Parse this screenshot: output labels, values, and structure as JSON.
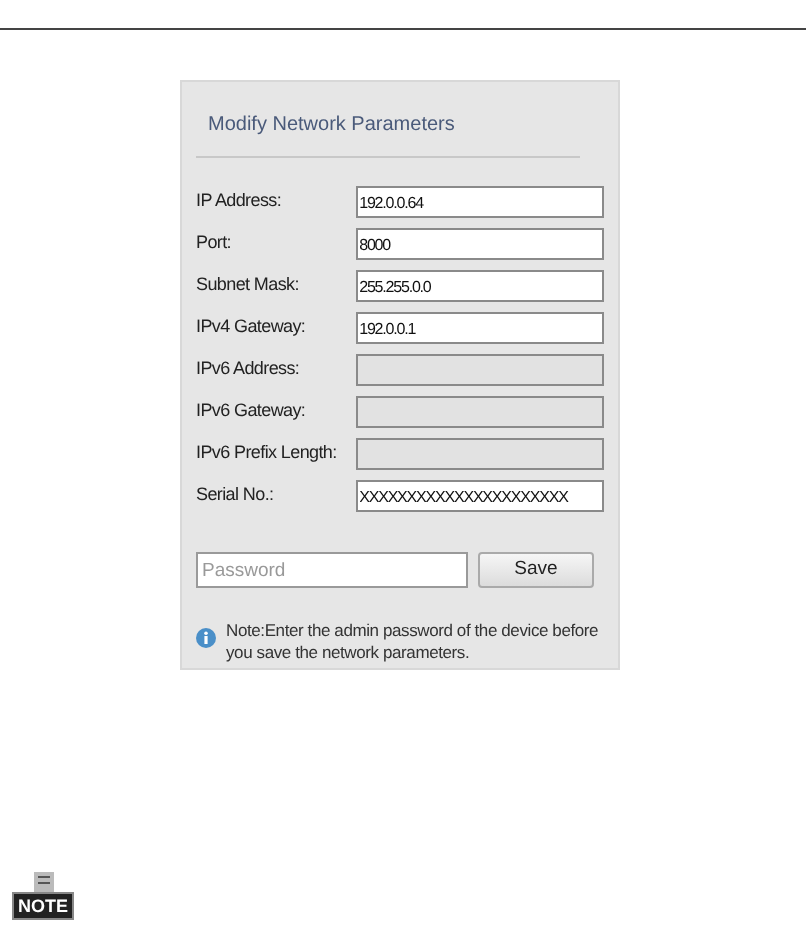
{
  "dialog": {
    "title": "Modify Network Parameters",
    "fields": [
      {
        "label": "IP Address:",
        "value": "192.0.0.64",
        "disabled": false
      },
      {
        "label": "Port:",
        "value": "8000",
        "disabled": false
      },
      {
        "label": "Subnet Mask:",
        "value": "255.255.0.0",
        "disabled": false
      },
      {
        "label": "IPv4 Gateway:",
        "value": "192.0.0.1",
        "disabled": false
      },
      {
        "label": "IPv6 Address:",
        "disabled": true
      },
      {
        "label": "IPv6 Gateway:",
        "disabled": true
      },
      {
        "label": "IPv6 Prefix Length:",
        "disabled": true
      },
      {
        "label": "Serial No.:",
        "value": "XXXXXXXXXXXXXXXXXXXXXX",
        "disabled": false
      }
    ],
    "password": {
      "placeholder": "Password"
    },
    "save_button": "Save",
    "note": "Note:Enter the admin password of the device before you save the network parameters."
  },
  "note_badge": "NOTE"
}
